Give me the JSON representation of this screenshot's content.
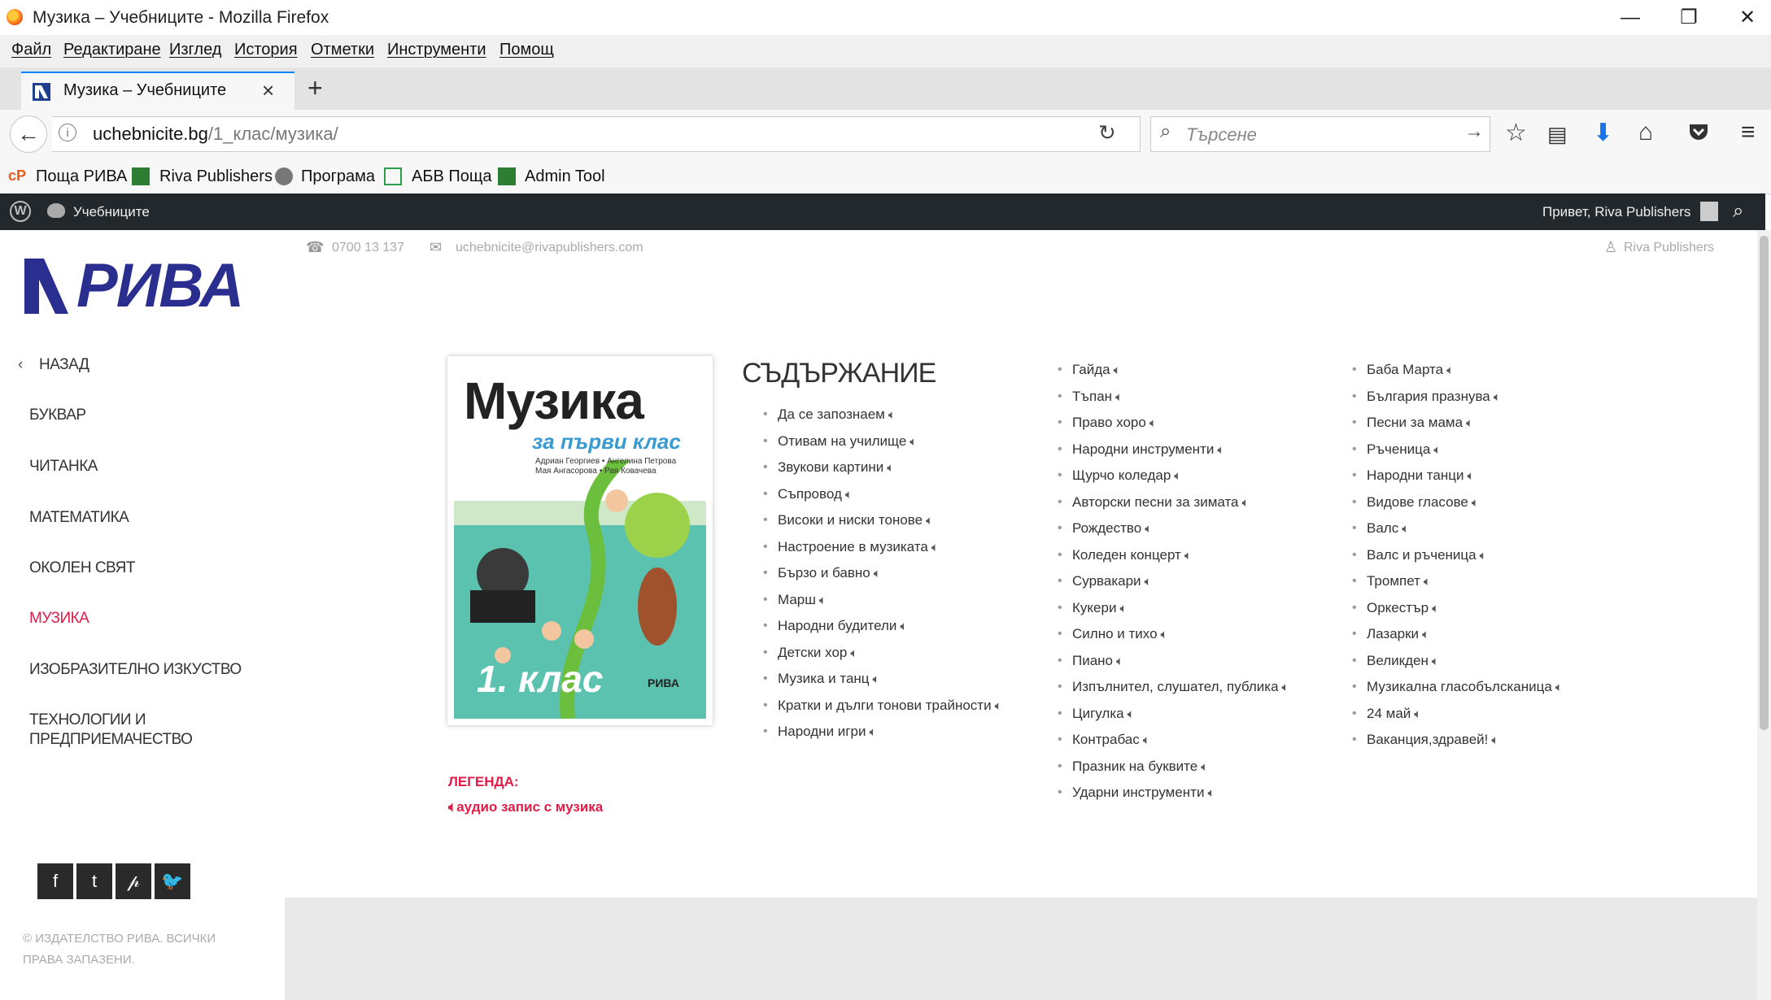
{
  "window": {
    "title": "Музика – Учебниците - Mozilla Firefox"
  },
  "menubar": {
    "items": [
      "Файл",
      "Редактиране",
      "Изглед",
      "История",
      "Отметки",
      "Инструменти",
      "Помощ"
    ]
  },
  "tab": {
    "title": "Музика – Учебниците"
  },
  "urlbar": {
    "host": "uchebnicite.bg",
    "path": "/1_клас/музика/"
  },
  "search": {
    "placeholder": "Търсене"
  },
  "bookmarks": [
    "Поща РИВА",
    "Riva Publishers",
    "Програма",
    "АБВ Поща",
    "Admin Tool"
  ],
  "adminbar": {
    "site": "Учебниците",
    "greeting": "Привет, Riva Publishers"
  },
  "header": {
    "phone": "0700 13 137",
    "email": "uchebnicite@rivapublishers.com",
    "user": "Riva Publishers"
  },
  "logo": {
    "text": "РИВА"
  },
  "sidebar": {
    "back": "НАЗАД",
    "items": [
      "БУКВАР",
      "ЧИТАНКА",
      "МАТЕМАТИКА",
      "ОКОЛЕН СВЯТ",
      "МУЗИКА",
      "ИЗОБРАЗИТЕЛНО ИЗКУСТВО",
      "ТЕХНОЛОГИИ И",
      "ПРЕДПРИЕМАЧЕСТВО"
    ],
    "copyright_1": "© ИЗДАТЕЛСТВО РИВА. ВСИЧКИ",
    "copyright_2": "ПРАВА ЗАПАЗЕНИ."
  },
  "cover": {
    "title": "Музика",
    "subtitle": "за първи клас",
    "authors_1": "Адриан Георгиев • Ангелина Петрова",
    "authors_2": "Мая Ангасорова • Рая Ковачева",
    "grade": "1. клас",
    "publisher": "РИВА"
  },
  "contents": {
    "title": "СЪДЪРЖАНИЕ",
    "col1": [
      "Да се запознаем",
      "Отивам на училище",
      "Звукови картини",
      "Съпровод",
      "Високи и ниски тонове",
      "Настроение в музиката",
      "Бързо и бавно",
      "Марш",
      "Народни будители",
      "Детски хор",
      "Музика и танц",
      "Кратки и дълги тонови трайности",
      "Народни игри"
    ],
    "col2": [
      "Гайда",
      "Тъпан",
      "Право хоро",
      "Народни инструменти",
      "Щурчо коледар",
      "Авторски песни за зимата",
      "Рождество",
      "Коледен концерт",
      "Сурвакари",
      "Кукери",
      "Силно и тихо",
      "Пиано",
      "Изпълнител, слушател, публика",
      "Цигулка",
      "Контрабас",
      "Празник на буквите",
      "Ударни инструменти"
    ],
    "col3": [
      "Баба Марта",
      "България празнува",
      "Песни за мама",
      "Ръченица",
      "Народни танци",
      "Видове гласове",
      "Валс",
      "Валс и ръченица",
      "Тромпет",
      "Оркестър",
      "Лазарки",
      "Великден",
      "Музикална гласобълсканица",
      "24 май",
      "Ваканция,здравей!"
    ]
  },
  "legend": {
    "title": "ЛЕГЕНДА:",
    "text": "аудио запис с музика"
  },
  "colors": {
    "accent": "#e01d48",
    "logo": "#2a2f8f",
    "adminbar": "#23282d"
  }
}
